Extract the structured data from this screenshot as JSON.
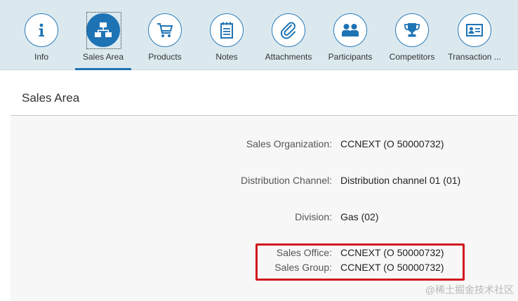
{
  "tabs": [
    {
      "label": "Info",
      "icon": "info-icon",
      "selected": false
    },
    {
      "label": "Sales Area",
      "icon": "hierarchy-icon",
      "selected": true
    },
    {
      "label": "Products",
      "icon": "cart-icon",
      "selected": false
    },
    {
      "label": "Notes",
      "icon": "notepad-icon",
      "selected": false
    },
    {
      "label": "Attachments",
      "icon": "paperclip-icon",
      "selected": false
    },
    {
      "label": "Participants",
      "icon": "people-icon",
      "selected": false
    },
    {
      "label": "Competitors",
      "icon": "trophy-icon",
      "selected": false
    },
    {
      "label": "Transaction ...",
      "icon": "contact-card-icon",
      "selected": false
    }
  ],
  "section": {
    "title": "Sales Area"
  },
  "fields": {
    "sales_org": {
      "label": "Sales Organization:",
      "value": "CCNEXT (O 50000732)"
    },
    "dist_channel": {
      "label": "Distribution Channel:",
      "value": "Distribution channel 01 (01)"
    },
    "division": {
      "label": "Division:",
      "value": "Gas (02)"
    },
    "sales_office": {
      "label": "Sales Office:",
      "value": "CCNEXT (O 50000732)"
    },
    "sales_group": {
      "label": "Sales Group:",
      "value": "CCNEXT (O 50000732)"
    }
  },
  "watermark": "@稀土掘金技术社区",
  "colors": {
    "tab_bar_bg": "#dbe9ef",
    "accent": "#1e73b5",
    "highlight_red": "#d0181e"
  }
}
